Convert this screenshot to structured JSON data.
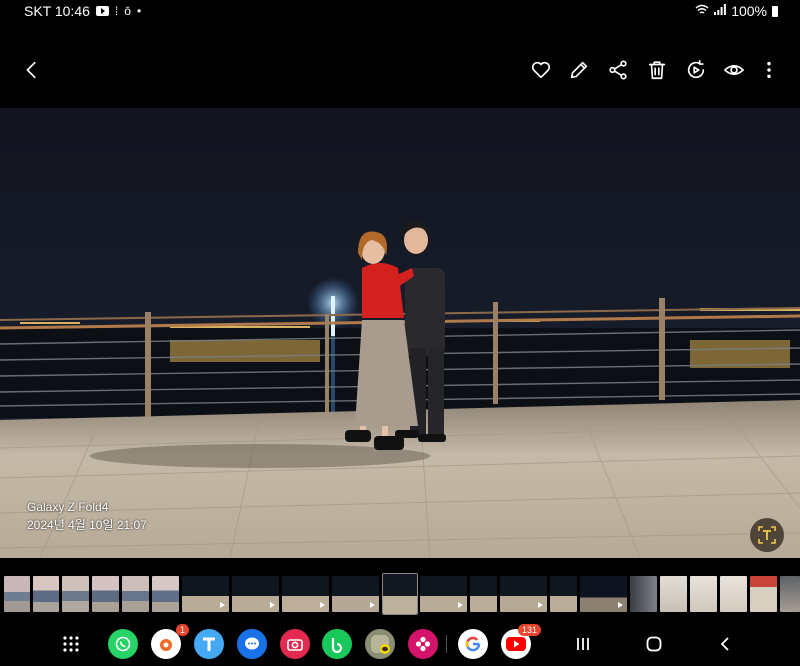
{
  "status_bar": {
    "carrier_time": "SKT 10:46",
    "battery": "100%"
  },
  "photo": {
    "device": "Galaxy Z Fold4",
    "datetime": "2024년 4월 10일 21:07"
  },
  "navbar": {
    "badges": {
      "galaxy_store": "1",
      "youtube": "131"
    }
  },
  "icons": {
    "toolbar": [
      "back-icon",
      "heart-icon",
      "edit-icon",
      "share-icon",
      "delete-icon",
      "remaster-icon",
      "eye-icon",
      "more-icon"
    ],
    "apps": [
      "apps-grid-icon",
      "whatsapp-icon",
      "galaxy-store-icon",
      "tmap-icon",
      "messages-icon",
      "camera-icon",
      "band-icon",
      "kakaotalk-icon",
      "gallery-icon",
      "google-icon",
      "youtube-icon"
    ]
  },
  "colors": {
    "background": "#000000",
    "badge": "#e8452c"
  }
}
